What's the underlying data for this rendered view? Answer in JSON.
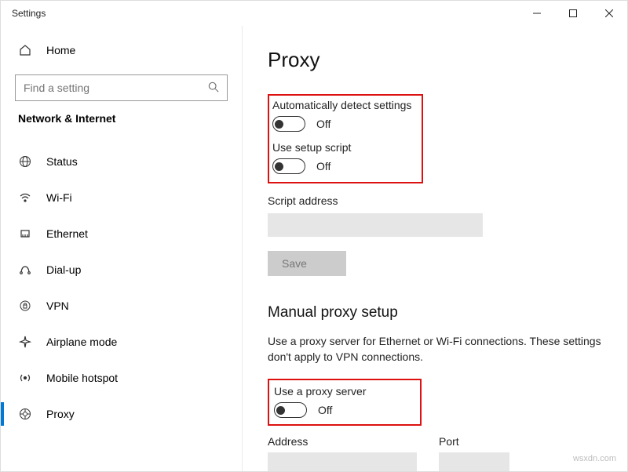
{
  "titlebar": {
    "title": "Settings"
  },
  "sidebar": {
    "home": "Home",
    "search_placeholder": "Find a setting",
    "category": "Network & Internet",
    "items": [
      {
        "label": "Status"
      },
      {
        "label": "Wi-Fi"
      },
      {
        "label": "Ethernet"
      },
      {
        "label": "Dial-up"
      },
      {
        "label": "VPN"
      },
      {
        "label": "Airplane mode"
      },
      {
        "label": "Mobile hotspot"
      },
      {
        "label": "Proxy"
      }
    ]
  },
  "main": {
    "title": "Proxy",
    "auto_detect_label": "Automatically detect settings",
    "auto_detect_state": "Off",
    "setup_script_label": "Use setup script",
    "setup_script_state": "Off",
    "script_address_label": "Script address",
    "save_label": "Save",
    "manual_section": "Manual proxy setup",
    "manual_desc": "Use a proxy server for Ethernet or Wi-Fi connections. These settings don't apply to VPN connections.",
    "use_proxy_label": "Use a proxy server",
    "use_proxy_state": "Off",
    "address_label": "Address",
    "port_label": "Port"
  },
  "watermark": "wsxdn.com"
}
